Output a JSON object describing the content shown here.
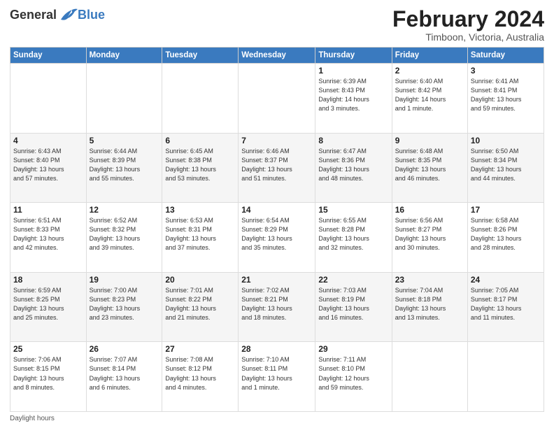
{
  "logo": {
    "general": "General",
    "blue": "Blue"
  },
  "title": "February 2024",
  "location": "Timboon, Victoria, Australia",
  "days_of_week": [
    "Sunday",
    "Monday",
    "Tuesday",
    "Wednesday",
    "Thursday",
    "Friday",
    "Saturday"
  ],
  "footer": "Daylight hours",
  "weeks": [
    [
      {
        "day": "",
        "info": ""
      },
      {
        "day": "",
        "info": ""
      },
      {
        "day": "",
        "info": ""
      },
      {
        "day": "",
        "info": ""
      },
      {
        "day": "1",
        "info": "Sunrise: 6:39 AM\nSunset: 8:43 PM\nDaylight: 14 hours\nand 3 minutes."
      },
      {
        "day": "2",
        "info": "Sunrise: 6:40 AM\nSunset: 8:42 PM\nDaylight: 14 hours\nand 1 minute."
      },
      {
        "day": "3",
        "info": "Sunrise: 6:41 AM\nSunset: 8:41 PM\nDaylight: 13 hours\nand 59 minutes."
      }
    ],
    [
      {
        "day": "4",
        "info": "Sunrise: 6:43 AM\nSunset: 8:40 PM\nDaylight: 13 hours\nand 57 minutes."
      },
      {
        "day": "5",
        "info": "Sunrise: 6:44 AM\nSunset: 8:39 PM\nDaylight: 13 hours\nand 55 minutes."
      },
      {
        "day": "6",
        "info": "Sunrise: 6:45 AM\nSunset: 8:38 PM\nDaylight: 13 hours\nand 53 minutes."
      },
      {
        "day": "7",
        "info": "Sunrise: 6:46 AM\nSunset: 8:37 PM\nDaylight: 13 hours\nand 51 minutes."
      },
      {
        "day": "8",
        "info": "Sunrise: 6:47 AM\nSunset: 8:36 PM\nDaylight: 13 hours\nand 48 minutes."
      },
      {
        "day": "9",
        "info": "Sunrise: 6:48 AM\nSunset: 8:35 PM\nDaylight: 13 hours\nand 46 minutes."
      },
      {
        "day": "10",
        "info": "Sunrise: 6:50 AM\nSunset: 8:34 PM\nDaylight: 13 hours\nand 44 minutes."
      }
    ],
    [
      {
        "day": "11",
        "info": "Sunrise: 6:51 AM\nSunset: 8:33 PM\nDaylight: 13 hours\nand 42 minutes."
      },
      {
        "day": "12",
        "info": "Sunrise: 6:52 AM\nSunset: 8:32 PM\nDaylight: 13 hours\nand 39 minutes."
      },
      {
        "day": "13",
        "info": "Sunrise: 6:53 AM\nSunset: 8:31 PM\nDaylight: 13 hours\nand 37 minutes."
      },
      {
        "day": "14",
        "info": "Sunrise: 6:54 AM\nSunset: 8:29 PM\nDaylight: 13 hours\nand 35 minutes."
      },
      {
        "day": "15",
        "info": "Sunrise: 6:55 AM\nSunset: 8:28 PM\nDaylight: 13 hours\nand 32 minutes."
      },
      {
        "day": "16",
        "info": "Sunrise: 6:56 AM\nSunset: 8:27 PM\nDaylight: 13 hours\nand 30 minutes."
      },
      {
        "day": "17",
        "info": "Sunrise: 6:58 AM\nSunset: 8:26 PM\nDaylight: 13 hours\nand 28 minutes."
      }
    ],
    [
      {
        "day": "18",
        "info": "Sunrise: 6:59 AM\nSunset: 8:25 PM\nDaylight: 13 hours\nand 25 minutes."
      },
      {
        "day": "19",
        "info": "Sunrise: 7:00 AM\nSunset: 8:23 PM\nDaylight: 13 hours\nand 23 minutes."
      },
      {
        "day": "20",
        "info": "Sunrise: 7:01 AM\nSunset: 8:22 PM\nDaylight: 13 hours\nand 21 minutes."
      },
      {
        "day": "21",
        "info": "Sunrise: 7:02 AM\nSunset: 8:21 PM\nDaylight: 13 hours\nand 18 minutes."
      },
      {
        "day": "22",
        "info": "Sunrise: 7:03 AM\nSunset: 8:19 PM\nDaylight: 13 hours\nand 16 minutes."
      },
      {
        "day": "23",
        "info": "Sunrise: 7:04 AM\nSunset: 8:18 PM\nDaylight: 13 hours\nand 13 minutes."
      },
      {
        "day": "24",
        "info": "Sunrise: 7:05 AM\nSunset: 8:17 PM\nDaylight: 13 hours\nand 11 minutes."
      }
    ],
    [
      {
        "day": "25",
        "info": "Sunrise: 7:06 AM\nSunset: 8:15 PM\nDaylight: 13 hours\nand 8 minutes."
      },
      {
        "day": "26",
        "info": "Sunrise: 7:07 AM\nSunset: 8:14 PM\nDaylight: 13 hours\nand 6 minutes."
      },
      {
        "day": "27",
        "info": "Sunrise: 7:08 AM\nSunset: 8:12 PM\nDaylight: 13 hours\nand 4 minutes."
      },
      {
        "day": "28",
        "info": "Sunrise: 7:10 AM\nSunset: 8:11 PM\nDaylight: 13 hours\nand 1 minute."
      },
      {
        "day": "29",
        "info": "Sunrise: 7:11 AM\nSunset: 8:10 PM\nDaylight: 12 hours\nand 59 minutes."
      },
      {
        "day": "",
        "info": ""
      },
      {
        "day": "",
        "info": ""
      }
    ]
  ]
}
